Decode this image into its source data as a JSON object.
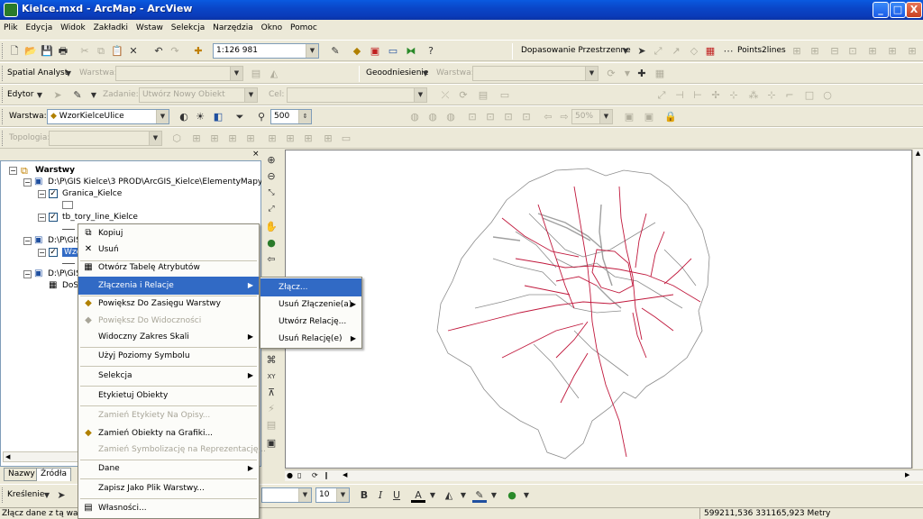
{
  "window": {
    "title": "Kielce.mxd - ArcMap - ArcView",
    "min_label": "_",
    "max_label": "□",
    "close_label": "X"
  },
  "menubar": [
    "Plik",
    "Edycja",
    "Widok",
    "Zakładki",
    "Wstaw",
    "Selekcja",
    "Narzędzia",
    "Okno",
    "Pomoc"
  ],
  "standard_toolbar": {
    "scale_value": "1:126 981",
    "georef_label": "Dopasowanie Przestrzenne",
    "points2lines_label": "Points2lines"
  },
  "spatial_analyst": {
    "label": "Spatial Analyst",
    "layer_label": "Warstwa:",
    "geo_label": "Geoodniesienie",
    "geo_layer_label": "Warstwa:"
  },
  "editor": {
    "label": "Edytor",
    "task_label": "Zadanie:",
    "task_value": "Utwórz Nowy Obiekt",
    "target_label": "Cel:"
  },
  "effects": {
    "layer_label": "Warstwa:",
    "layer_value": "WzorKielceUlice",
    "size_value": "500",
    "percent_value": "50%"
  },
  "topology": {
    "label": "Topologia:"
  },
  "toc": {
    "root": "Warstwy",
    "items": [
      {
        "label": "D:\\P\\GIS Kielce\\3 PROD\\ArcGIS_Kielce\\ElementyMapy"
      },
      {
        "label": "Granica_Kielce"
      },
      {
        "label": "tb_tory_line_Kielce"
      },
      {
        "label": "D:\\P\\GIS"
      },
      {
        "label": "Wzo"
      },
      {
        "label": "D:\\P\\GIS"
      },
      {
        "label": "DoSl"
      }
    ],
    "tabs": [
      "Nazwy",
      "Źródła"
    ]
  },
  "context_menu": {
    "items": [
      {
        "label": "Kopiuj",
        "enabled": true
      },
      {
        "label": "Usuń",
        "enabled": true
      },
      {
        "label": "Otwórz Tabelę Atrybutów",
        "enabled": true
      },
      {
        "label": "Złączenia i Relacje",
        "enabled": true
      },
      {
        "label": "Powiększ Do Zasięgu Warstwy",
        "enabled": true
      },
      {
        "label": "Powiększ Do Widoczności",
        "enabled": false
      },
      {
        "label": "Widoczny Zakres Skali",
        "enabled": true
      },
      {
        "label": "Użyj Poziomy Symbolu",
        "enabled": true
      },
      {
        "label": "Selekcja",
        "enabled": true
      },
      {
        "label": "Etykietuj Obiekty",
        "enabled": true
      },
      {
        "label": "Zamień Etykiety Na Opisy...",
        "enabled": false
      },
      {
        "label": "Zamień Obiekty na Grafiki...",
        "enabled": true
      },
      {
        "label": "Zamień Symbolizację na Reprezentację...",
        "enabled": false
      },
      {
        "label": "Dane",
        "enabled": true
      },
      {
        "label": "Zapisz Jako Plik Warstwy...",
        "enabled": true
      },
      {
        "label": "Własności...",
        "enabled": true
      }
    ]
  },
  "submenu": {
    "items": [
      "Złącz...",
      "Usuń Złączenie(a)",
      "Utwórz Relację...",
      "Usuń Relację(e)"
    ]
  },
  "draw_toolbar": {
    "label": "Kreślenie",
    "font_size": "10"
  },
  "statusbar": {
    "message": "Złącz dane z tą warstw",
    "coords": "599211,536  331165,923 Metry"
  },
  "colors": {
    "roads": "#c0183c",
    "boundary": "#8c8c8c",
    "highlight": "#316ac5"
  }
}
